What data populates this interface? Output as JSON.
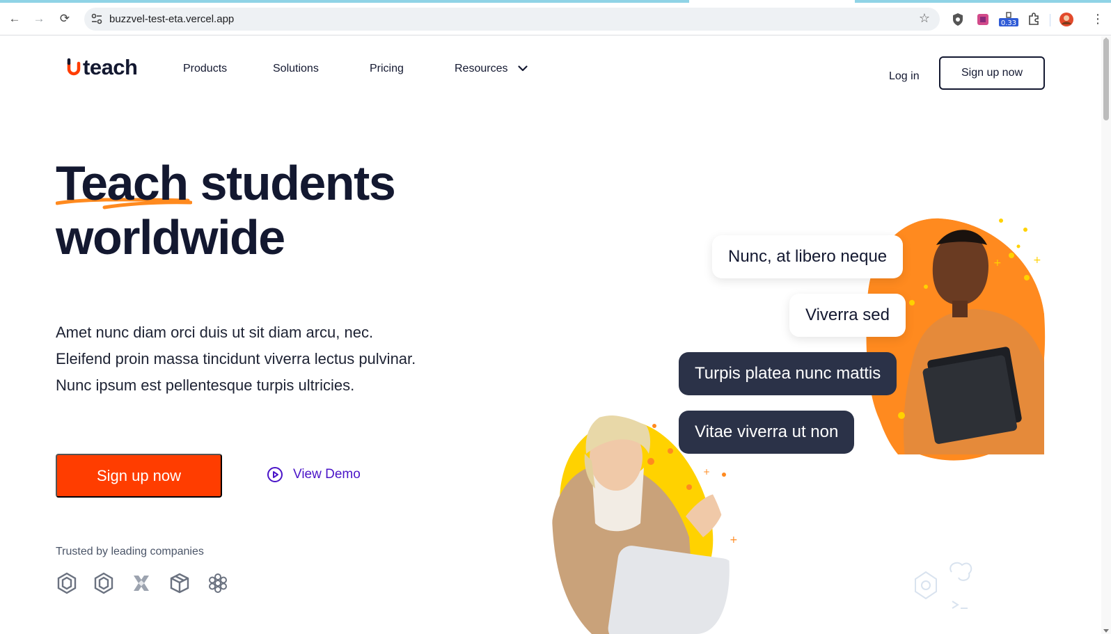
{
  "browser": {
    "url": "buzzvel-test-eta.vercel.app",
    "extension_badge": "0.33"
  },
  "nav": {
    "logo_text": "teach",
    "items": [
      "Products",
      "Solutions",
      "Pricing",
      "Resources"
    ],
    "login": "Log in",
    "signup": "Sign up now"
  },
  "hero": {
    "headline_word1": "Teach",
    "headline_rest": "students",
    "headline_line2": "worldwide",
    "lead_lines": [
      "Amet nunc diam orci duis ut sit diam arcu, nec.",
      "Eleifend proin massa tincidunt viverra lectus pulvinar.",
      "Nunc ipsum est pellentesque turpis ultricies."
    ],
    "cta": "Sign up now",
    "demo": "View Demo",
    "trusted": "Trusted by leading companies",
    "companies": [
      "hexagon-logo",
      "hexagon-logo-2",
      "cross-logo",
      "cube-logo",
      "flower-logo"
    ]
  },
  "bubbles": [
    {
      "text": "Nunc, at libero neque",
      "style": "light"
    },
    {
      "text": "Viverra sed",
      "style": "light"
    },
    {
      "text": "Turpis platea nunc mattis",
      "style": "dark"
    },
    {
      "text": "Vitae viverra ut non",
      "style": "dark"
    }
  ],
  "colors": {
    "brand_orange": "#ff3d00",
    "accent_purple": "#4a14c8",
    "navy": "#131830",
    "bubble_dark": "#2b3248",
    "blob_orange": "#ff8a1f",
    "blob_yellow": "#ffd200"
  }
}
